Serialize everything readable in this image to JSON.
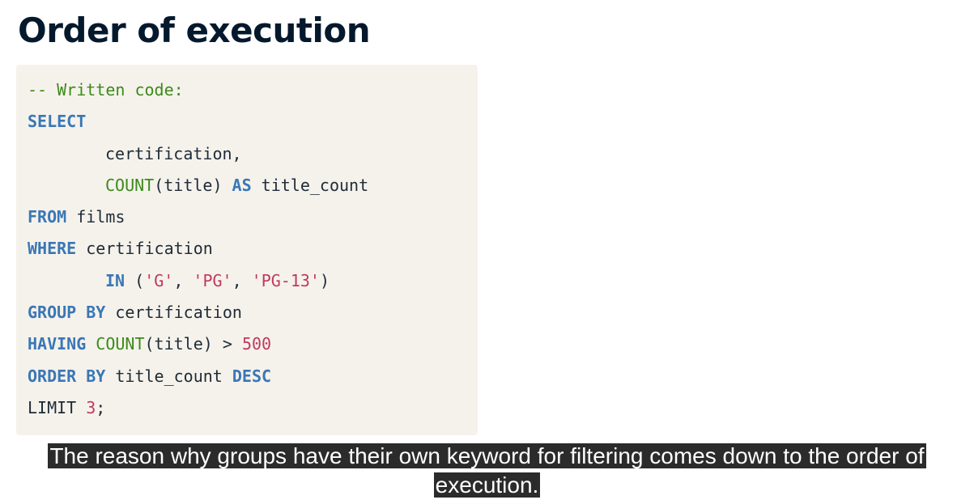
{
  "title": "Order of execution",
  "code": {
    "comment": "-- Written code:",
    "select_kw": "SELECT",
    "col_certification": "certification,",
    "count_fn_1": "COUNT",
    "count_arg_1": "(title) ",
    "as_kw": "AS",
    "alias": " title_count",
    "from_kw": "FROM",
    "table": " films",
    "where_kw": "WHERE",
    "where_col": " certification",
    "in_kw": "IN",
    "in_open": " (",
    "str_g": "'G'",
    "comma_1": ", ",
    "str_pg": "'PG'",
    "comma_2": ", ",
    "str_pg13": "'PG-13'",
    "in_close": ")",
    "group_kw": "GROUP BY",
    "group_col": " certification",
    "having_kw": "HAVING",
    "having_sp": " ",
    "count_fn_2": "COUNT",
    "count_arg_2": "(title) > ",
    "having_num": "500",
    "order_kw": "ORDER BY",
    "order_col": " title_count ",
    "desc_kw": "DESC",
    "limit_kw": "LIMIT ",
    "limit_num": "3",
    "semicolon": ";"
  },
  "caption": "The reason why groups have their own keyword for filtering comes down to the order of execution."
}
